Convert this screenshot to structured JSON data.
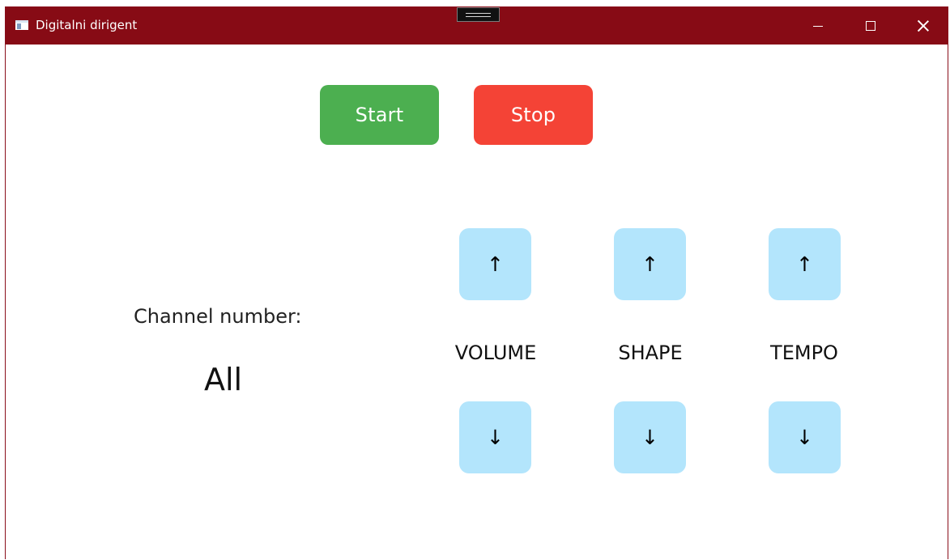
{
  "window": {
    "title": "Digitalni dirigent",
    "titlebar_color": "#870b15"
  },
  "controls": {
    "start_label": "Start",
    "stop_label": "Stop",
    "start_color": "#4caf50",
    "stop_color": "#f44336"
  },
  "channel": {
    "label": "Channel number:",
    "value": "All"
  },
  "parameters": [
    {
      "name": "VOLUME",
      "up_icon": "↑",
      "down_icon": "↓"
    },
    {
      "name": "SHAPE",
      "up_icon": "↑",
      "down_icon": "↓"
    },
    {
      "name": "TEMPO",
      "up_icon": "↑",
      "down_icon": "↓"
    }
  ],
  "colors": {
    "arrow_button_bg": "#b3e5fc"
  }
}
